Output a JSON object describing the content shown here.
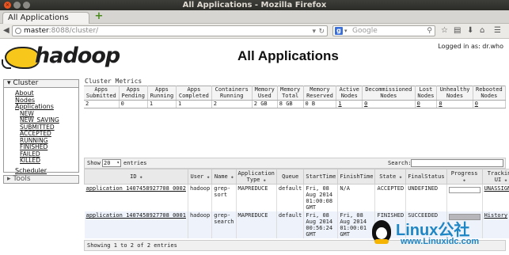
{
  "window": {
    "title": "All Applications - Mozilla Firefox",
    "tab_title": "All Applications",
    "new_tab_icon": "plus-icon"
  },
  "navbar": {
    "url_host": "master",
    "url_path": ":8088/cluster/",
    "search_engine_badge": "g",
    "search_placeholder": "Google"
  },
  "page": {
    "logo_word": "hadoop",
    "title": "All Applications",
    "logged_in": "Logged in as: dr.who"
  },
  "sidebar": {
    "cluster_label": "Cluster",
    "cluster_links": [
      "About",
      "Nodes",
      "Applications"
    ],
    "app_states": [
      "NEW",
      "NEW_SAVING",
      "SUBMITTED",
      "ACCEPTED",
      "RUNNING",
      "FINISHED",
      "FAILED",
      "KILLED"
    ],
    "scheduler_label": "Scheduler",
    "tools_label": "Tools"
  },
  "metrics": {
    "label": "Cluster Metrics",
    "headers": [
      "Apps Submitted",
      "Apps Pending",
      "Apps Running",
      "Apps Completed",
      "Containers Running",
      "Memory Used",
      "Memory Total",
      "Memory Reserved",
      "Active Nodes",
      "Decommissioned Nodes",
      "Lost Nodes",
      "Unhealthy Nodes",
      "Rebooted Nodes"
    ],
    "values": [
      "2",
      "0",
      "1",
      "1",
      "2",
      "2 GB",
      "8 GB",
      "0 B",
      "1",
      "0",
      "0",
      "0",
      "0"
    ]
  },
  "apps_table": {
    "show_label": "Show",
    "entries_value": "20",
    "entries_label": "entries",
    "search_label": "Search:",
    "headers": [
      "ID",
      "User",
      "Name",
      "Application Type",
      "Queue",
      "StartTime",
      "FinishTime",
      "State",
      "FinalStatus",
      "Progress",
      "Tracking UI"
    ],
    "rows": [
      {
        "id": "application_1407458927708_0002",
        "user": "hadoop",
        "name": "grep-sort",
        "type": "MAPREDUCE",
        "queue": "default",
        "start": "Fri, 08 Aug 2014 01:00:08 GMT",
        "finish": "N/A",
        "state": "ACCEPTED",
        "final_status": "UNDEFINED",
        "progress": 0,
        "tracking": "UNASSIGNED"
      },
      {
        "id": "application_1407458927708_0001",
        "user": "hadoop",
        "name": "grep-search",
        "type": "MAPREDUCE",
        "queue": "default",
        "start": "Fri, 08 Aug 2014 00:56:24 GMT",
        "finish": "Fri, 08 Aug 2014 01:00:01 GMT",
        "state": "FINISHED",
        "final_status": "SUCCEEDED",
        "progress": 100,
        "tracking": "History"
      }
    ],
    "footer": "Showing 1 to 2 of 2 entries"
  },
  "watermark": {
    "main": "Linux公社",
    "sub": "www.Linuxidc.com"
  }
}
